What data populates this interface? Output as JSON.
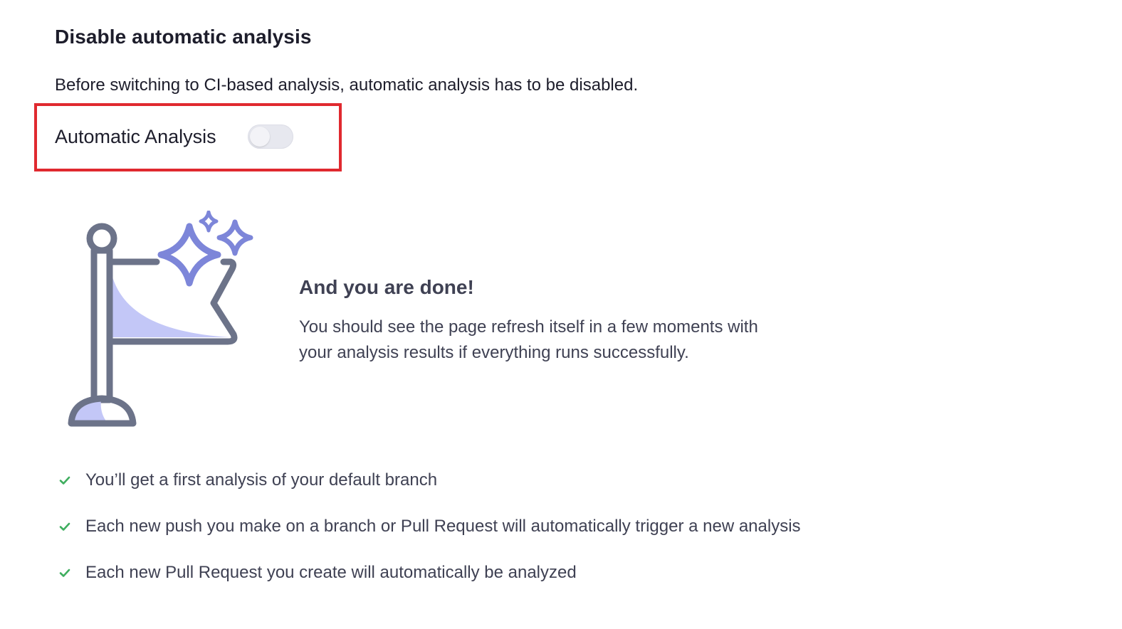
{
  "section": {
    "title": "Disable automatic analysis",
    "description": "Before switching to CI-based analysis, automatic analysis has to be disabled."
  },
  "toggle": {
    "label": "Automatic Analysis",
    "state": "off"
  },
  "done": {
    "title": "And you are done!",
    "line1": "You should see the page refresh itself in a few moments with",
    "line2": "your analysis results if everything runs successfully."
  },
  "benefits": [
    {
      "text": "You’ll get a first analysis of your default branch",
      "icon": "check-icon"
    },
    {
      "text": "Each new push you make on a branch or Pull Request will automatically trigger a new analysis",
      "icon": "check-icon"
    },
    {
      "text": "Each new Pull Request you create will automatically be analyzed",
      "icon": "check-icon"
    }
  ],
  "colors": {
    "highlight": "#e0292f",
    "check": "#3fae5f",
    "flag_fill": "#c3c7f7",
    "flag_stroke": "#6c7389",
    "sparkle": "#7d86d9"
  }
}
